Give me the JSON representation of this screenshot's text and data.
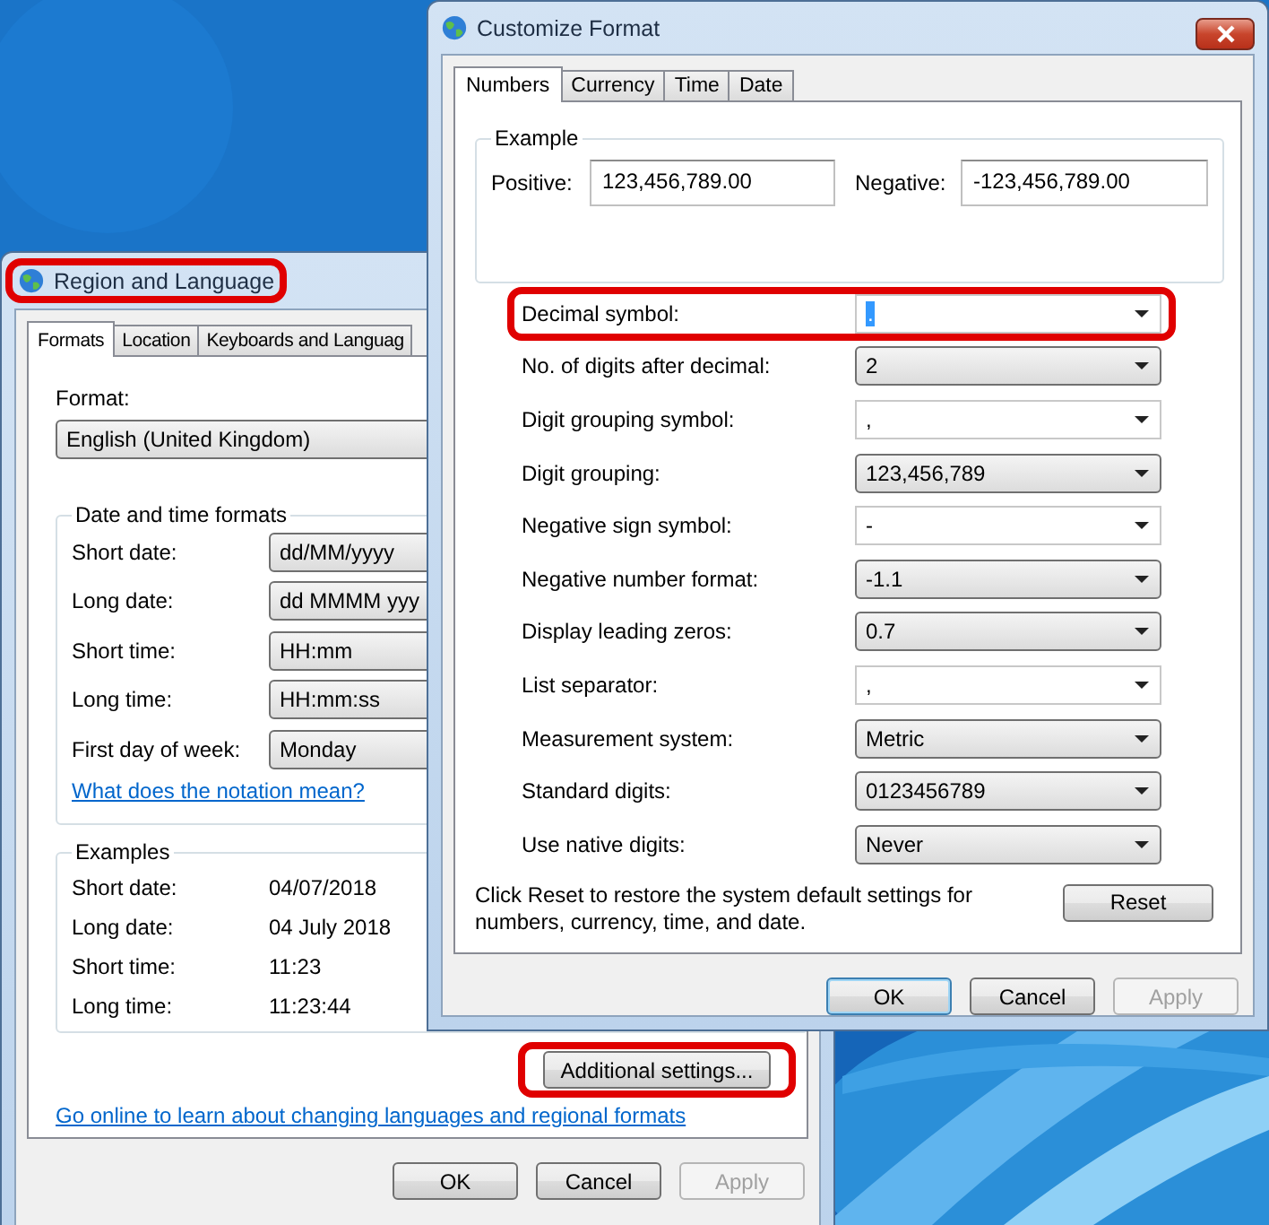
{
  "region_window": {
    "title": "Region and Language",
    "title_highlighted": true,
    "tabs": [
      {
        "label": "Formats",
        "selected": true
      },
      {
        "label": "Location",
        "selected": false
      },
      {
        "label": "Keyboards and Languag",
        "selected": false
      }
    ],
    "format_label": "Format:",
    "format_value": "English (United Kingdom)",
    "date_time_group": {
      "title": "Date and time formats",
      "rows": [
        {
          "label": "Short date:",
          "value": "dd/MM/yyyy"
        },
        {
          "label": "Long date:",
          "value": "dd MMMM yyy"
        },
        {
          "label": "Short time:",
          "value": "HH:mm"
        },
        {
          "label": "Long time:",
          "value": "HH:mm:ss"
        },
        {
          "label": "First day of week:",
          "value": "Monday"
        }
      ],
      "link": "What does the notation mean?"
    },
    "examples_group": {
      "title": "Examples",
      "rows": [
        {
          "label": "Short date:",
          "value": "04/07/2018"
        },
        {
          "label": "Long date:",
          "value": "04 July 2018"
        },
        {
          "label": "Short time:",
          "value": "11:23"
        },
        {
          "label": "Long time:",
          "value": "11:23:44"
        }
      ]
    },
    "additional_button": {
      "label": "Additional settings...",
      "highlighted": true
    },
    "online_link": "Go online to learn about changing languages and regional formats",
    "buttons": [
      {
        "label": "OK",
        "disabled": false,
        "default": false
      },
      {
        "label": "Cancel",
        "disabled": false,
        "default": false
      },
      {
        "label": "Apply",
        "disabled": true,
        "default": false
      }
    ]
  },
  "customize_window": {
    "title": "Customize Format",
    "tabs": [
      {
        "label": "Numbers",
        "selected": true
      },
      {
        "label": "Currency",
        "selected": false
      },
      {
        "label": "Time",
        "selected": false
      },
      {
        "label": "Date",
        "selected": false
      }
    ],
    "example_group": {
      "title": "Example",
      "positive_label": "Positive:",
      "positive_value": "123,456,789.00",
      "negative_label": "Negative:",
      "negative_value": "-123,456,789.00"
    },
    "settings": [
      {
        "label": "Decimal symbol:",
        "value": ".",
        "kind": "editable",
        "highlighted": true
      },
      {
        "label": "No. of digits after decimal:",
        "value": "2",
        "kind": "list",
        "highlighted": false
      },
      {
        "label": "Digit grouping symbol:",
        "value": ",",
        "kind": "editable",
        "highlighted": false
      },
      {
        "label": "Digit grouping:",
        "value": "123,456,789",
        "kind": "list",
        "highlighted": false
      },
      {
        "label": "Negative sign symbol:",
        "value": "-",
        "kind": "editable",
        "highlighted": false
      },
      {
        "label": "Negative number format:",
        "value": "-1.1",
        "kind": "list",
        "highlighted": false
      },
      {
        "label": "Display leading zeros:",
        "value": "0.7",
        "kind": "list",
        "highlighted": false
      },
      {
        "label": "List separator:",
        "value": ",",
        "kind": "editable",
        "highlighted": false
      },
      {
        "label": "Measurement system:",
        "value": "Metric",
        "kind": "list",
        "highlighted": false
      },
      {
        "label": "Standard digits:",
        "value": "0123456789",
        "kind": "list",
        "highlighted": false
      },
      {
        "label": "Use native digits:",
        "value": "Never",
        "kind": "list",
        "highlighted": false
      }
    ],
    "reset_note": "Click Reset to restore the system default settings for numbers, currency, time, and date.",
    "reset_button": "Reset",
    "buttons": [
      {
        "label": "OK",
        "disabled": false,
        "default": true
      },
      {
        "label": "Cancel",
        "disabled": false,
        "default": false
      },
      {
        "label": "Apply",
        "disabled": true,
        "default": false
      }
    ]
  }
}
